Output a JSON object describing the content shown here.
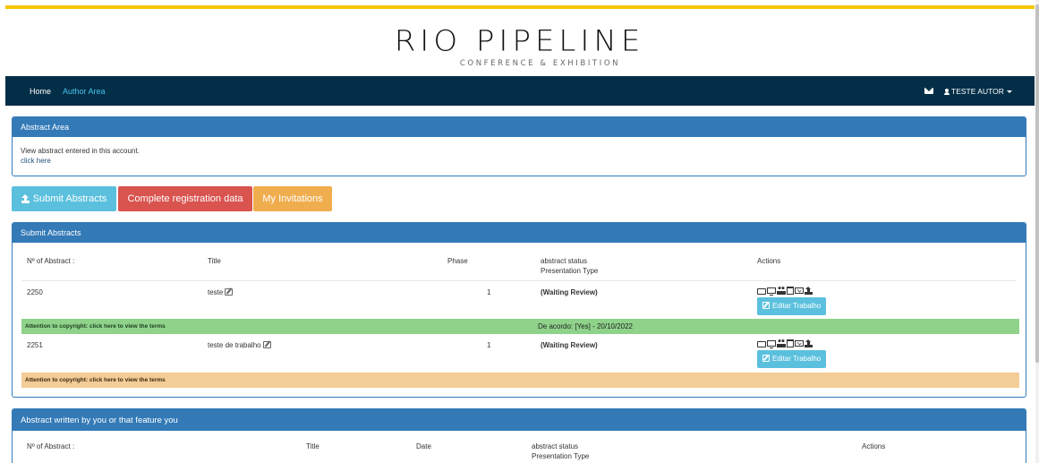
{
  "logo": {
    "main": "RIO PIPELINE",
    "sub": "CONFERENCE & EXHIBITION"
  },
  "nav": {
    "home": "Home",
    "author_area": "Author Area",
    "user": "TESTE AUTOR"
  },
  "abstract_area": {
    "title": "Abstract Area",
    "text": "View abstract entered in this account.",
    "link": "click here"
  },
  "buttons": {
    "submit": "Submit Abstracts",
    "complete": "Complete registration data",
    "invitations": "My Invitations"
  },
  "submit_panel": {
    "title": "Submit Abstracts",
    "headers": {
      "number": "Nº of Abstract :",
      "title": "Title",
      "phase": "Phase",
      "status": "abstract status",
      "presentation": "Presentation Type",
      "actions": "Actions"
    },
    "rows": [
      {
        "number": "2250",
        "title": "teste",
        "phase": "1",
        "status": "(Waiting Review)",
        "edit": "Editar Trabalho",
        "notice": "Attention to copyright: click here to view the terms",
        "agreement": "De acordo: [Yes] - 20/10/2022"
      },
      {
        "number": "2251",
        "title": "teste de trabalho",
        "phase": "1",
        "status": "(Waiting Review)",
        "edit": "Editar Trabalho",
        "notice": "Attention to copyright: click here to view the terms"
      }
    ]
  },
  "written_panel": {
    "title": "Abstract written by you or that feature you",
    "headers": {
      "number": "Nº of Abstract :",
      "title": "Title",
      "date": "Date",
      "status": "abstract status",
      "presentation": "Presentation Type",
      "actions": "Actions"
    }
  },
  "colors": {
    "top_accent": "#f7c600",
    "navbar": "#032e47",
    "panel_primary": "#337ab7",
    "info": "#5bc0de",
    "danger": "#d9534f",
    "warning": "#f0ad4e",
    "row_success": "#8fd38b",
    "row_warning": "#f4cc97"
  }
}
